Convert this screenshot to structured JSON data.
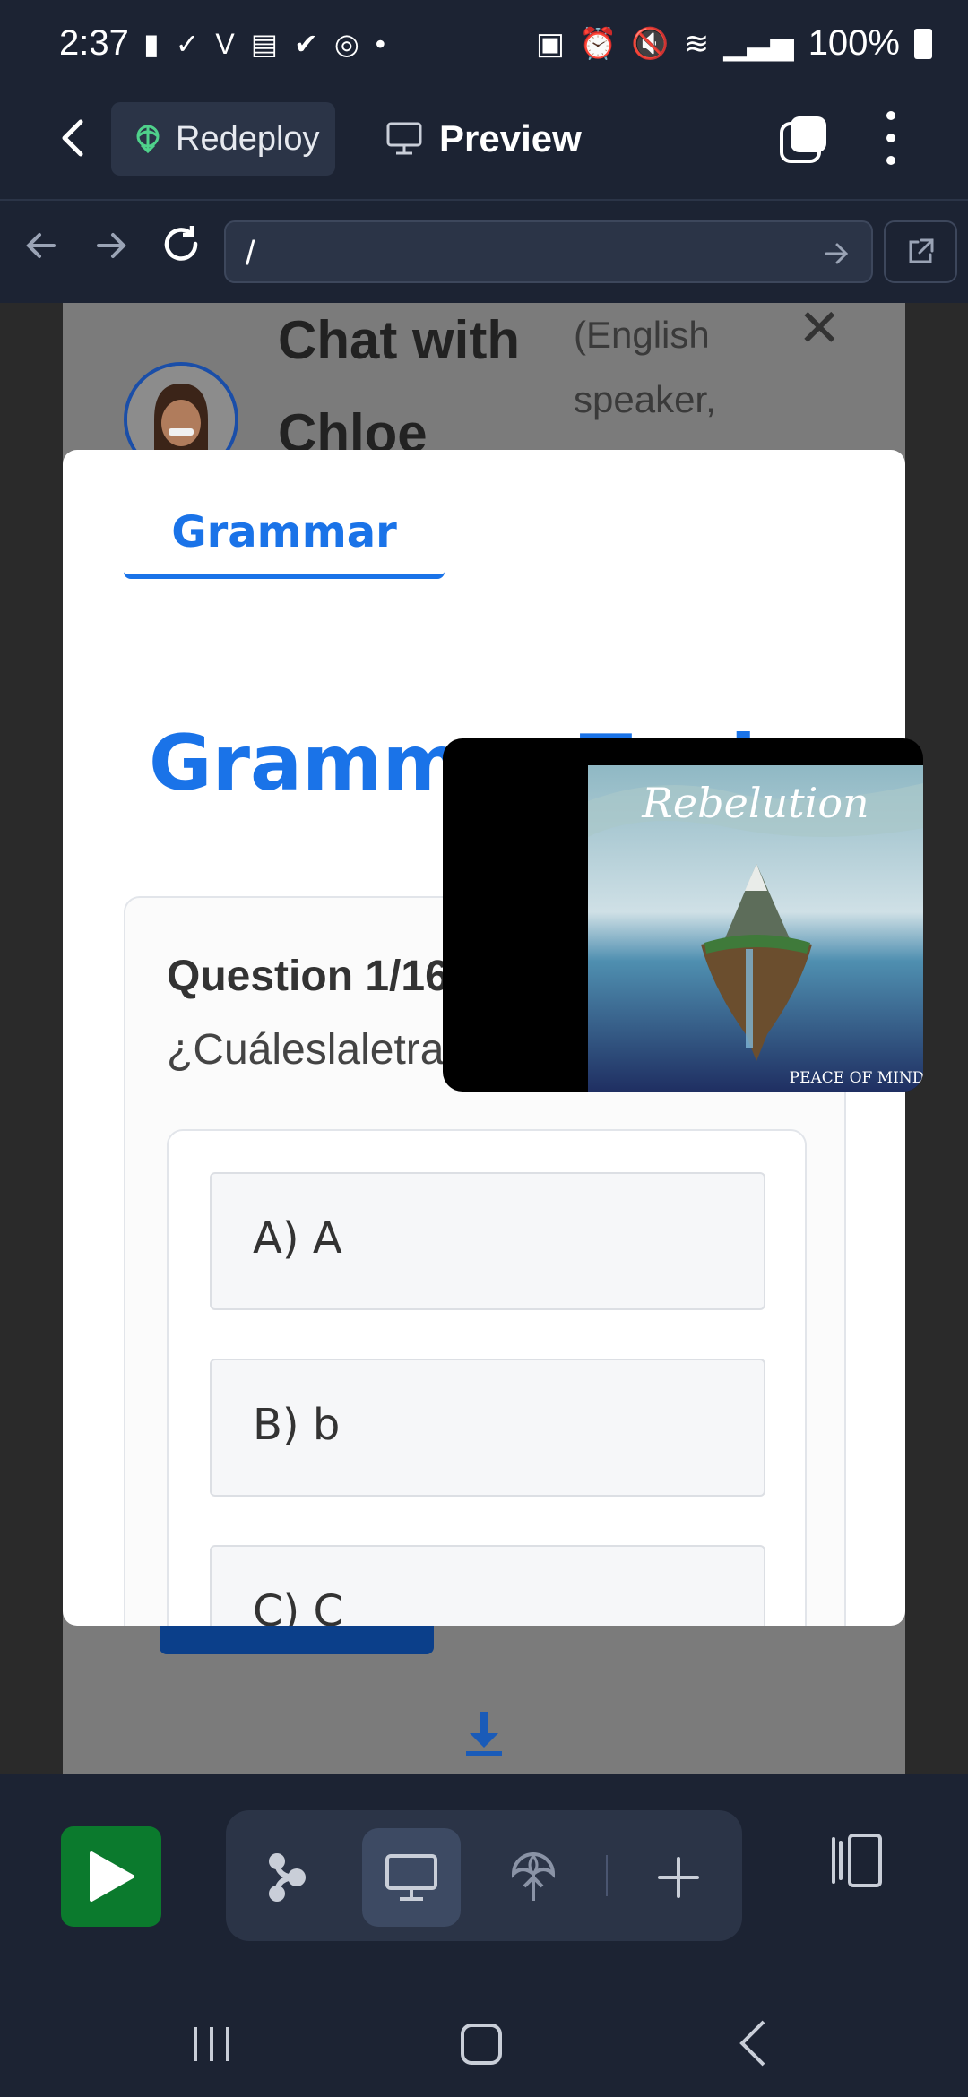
{
  "status_bar": {
    "time": "2:37",
    "battery_text": "100%"
  },
  "header": {
    "redeploy_label": "Redeploy",
    "preview_label": "Preview"
  },
  "url_bar": {
    "value": "/"
  },
  "page": {
    "chat_title_line1": "Chat with",
    "chat_title_line2": "Chloe",
    "chat_subtitle": "(English speaker,"
  },
  "modal": {
    "tab_label": "Grammar",
    "title": "Grammar Topics",
    "question_number": "Question 1/16:",
    "question_text": "¿Cuáleslaletramayúscula'A'?",
    "options": [
      "A) A",
      "B) b",
      "C) C"
    ]
  },
  "media": {
    "album_title": "Rebelution",
    "album_subtitle": "PEACE OF MIND"
  },
  "colors": {
    "accent": "#1a73e8",
    "app_bg": "#1c2333",
    "run_green": "#0b7a2d"
  }
}
